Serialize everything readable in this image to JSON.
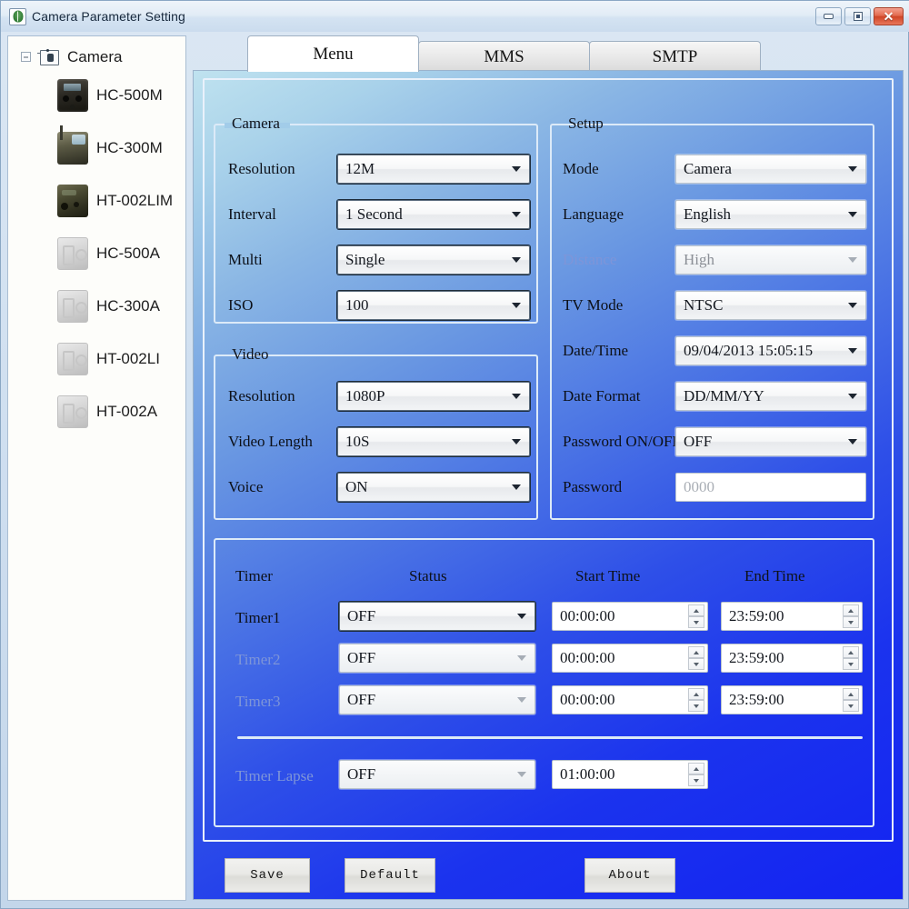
{
  "window": {
    "title": "Camera Parameter Setting",
    "app_icon": "leaf-icon",
    "buttons": {
      "minimize": "minimize-icon",
      "maximize": "maximize-icon",
      "close": "✕"
    }
  },
  "sidebar": {
    "root": {
      "label": "Camera",
      "expander": "collapse-icon"
    },
    "items": [
      {
        "label": "HC-500M",
        "icon": "camera-photo-dark"
      },
      {
        "label": "HC-300M",
        "icon": "camera-photo-olive"
      },
      {
        "label": "HT-002LIM",
        "icon": "camera-photo-camo"
      },
      {
        "label": "HC-500A",
        "icon": "camera-placeholder"
      },
      {
        "label": "HC-300A",
        "icon": "camera-placeholder"
      },
      {
        "label": "HT-002LI",
        "icon": "camera-placeholder"
      },
      {
        "label": "HT-002A",
        "icon": "camera-placeholder"
      }
    ]
  },
  "tabs": [
    {
      "label": "Menu",
      "active": true
    },
    {
      "label": "MMS",
      "active": false
    },
    {
      "label": "SMTP",
      "active": false
    }
  ],
  "camera_group": {
    "title": "Camera",
    "rows": [
      {
        "label": "Resolution",
        "value": "12M",
        "disabled": false
      },
      {
        "label": "Interval",
        "value": "1  Second",
        "disabled": false
      },
      {
        "label": "Multi",
        "value": "Single",
        "disabled": false
      },
      {
        "label": "ISO",
        "value": "100",
        "disabled": false
      }
    ]
  },
  "video_group": {
    "title": "Video",
    "rows": [
      {
        "label": "Resolution",
        "value": "1080P",
        "disabled": false
      },
      {
        "label": "Video Length",
        "value": "10S",
        "disabled": false
      },
      {
        "label": "Voice",
        "value": "ON",
        "disabled": false
      }
    ]
  },
  "setup_group": {
    "title": "Setup",
    "rows": [
      {
        "label": "Mode",
        "value": "Camera",
        "disabled": false,
        "type": "combo"
      },
      {
        "label": "Language",
        "value": "English",
        "disabled": false,
        "type": "combo"
      },
      {
        "label": "Distance",
        "value": "High",
        "disabled": true,
        "type": "combo"
      },
      {
        "label": "TV Mode",
        "value": "NTSC",
        "disabled": false,
        "type": "combo"
      },
      {
        "label": "Date/Time",
        "value": "09/04/2013 15:05:15",
        "disabled": false,
        "type": "combo"
      },
      {
        "label": "Date Format",
        "value": "DD/MM/YY",
        "disabled": false,
        "type": "combo"
      },
      {
        "label": "Password ON/OFF",
        "value": "OFF",
        "disabled": false,
        "type": "combo"
      },
      {
        "label": "Password",
        "value": "0000",
        "disabled": false,
        "type": "text",
        "ghost": true
      }
    ]
  },
  "timer_group": {
    "headers": [
      "Timer",
      "Status",
      "Start Time",
      "End Time"
    ],
    "rows": [
      {
        "label": "Timer1",
        "status": "OFF",
        "start": "00:00:00",
        "end": "23:59:00",
        "disabled": false
      },
      {
        "label": "Timer2",
        "status": "OFF",
        "start": "00:00:00",
        "end": "23:59:00",
        "disabled": true
      },
      {
        "label": "Timer3",
        "status": "OFF",
        "start": "00:00:00",
        "end": "23:59:00",
        "disabled": true
      }
    ],
    "lapse": {
      "label": "Timer Lapse",
      "status": "OFF",
      "interval": "01:00:00",
      "disabled": true
    }
  },
  "footer": {
    "save": "Save",
    "default": "Default",
    "about": "About"
  },
  "colors": {
    "panel_top": "#bfe2ef",
    "panel_bottom": "#1323f2",
    "close_button": "#cf4526",
    "disabled_label": "#7e95d8",
    "sidebar_bg": "#fdfdfa"
  }
}
